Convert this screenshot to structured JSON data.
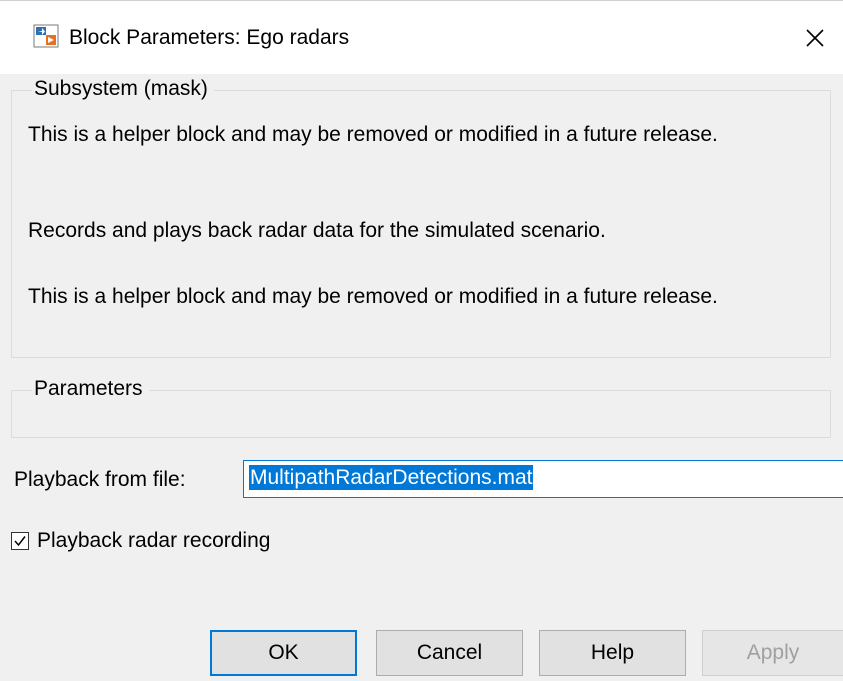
{
  "window": {
    "title": "Block Parameters: Ego radars",
    "close_icon": "close-icon",
    "app_icon": "simulink-block-icon"
  },
  "mask_group": {
    "legend": "Subsystem (mask)",
    "description_1": "This is a helper block and may be removed or modified in a future release.",
    "description_2": "Records and plays back radar data for the simulated scenario.",
    "description_3": "This is a helper block and may be removed or modified in a future release."
  },
  "parameters_group": {
    "legend": "Parameters"
  },
  "playback_file": {
    "label": "Playback from file:",
    "value": "MultipathRadarDetections.mat"
  },
  "playback_checkbox": {
    "label": "Playback radar recording",
    "checked": true
  },
  "buttons": {
    "ok": "OK",
    "cancel": "Cancel",
    "help": "Help",
    "apply": "Apply"
  },
  "colors": {
    "accent": "#0078d7",
    "background": "#f0f0f0",
    "disabled_text": "#a0a0a0"
  }
}
